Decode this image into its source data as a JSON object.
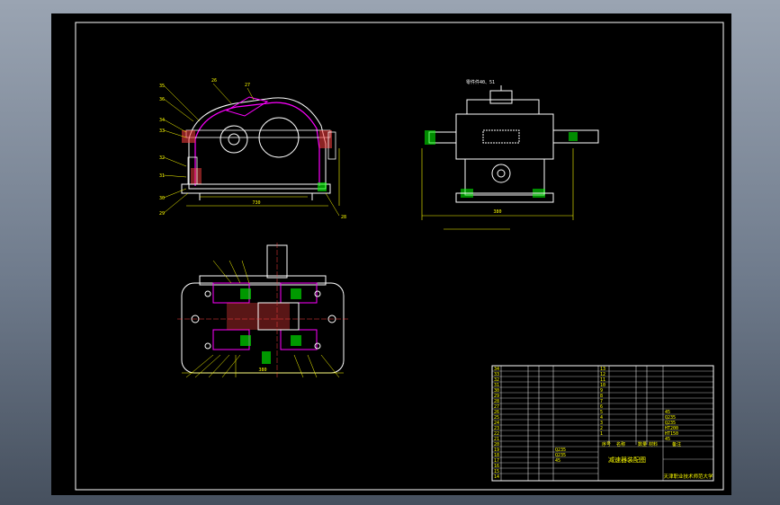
{
  "colors": {
    "background": "#000000",
    "frame": "#ffffff",
    "dimension": "#ffff00",
    "outline": "#ffffff",
    "section": "#ff00ff",
    "hatch": "#ff4040",
    "fill": "#00ff00",
    "leader": "#00ffff"
  },
  "drawing": {
    "side_view_label": "零件件40、51",
    "assembly_title": "减速器装配图",
    "institution": "天津职业技术师范大学",
    "dim_base_front": "730",
    "dim_base_side": "380",
    "dim_inner_front": "380"
  },
  "title_block": {
    "row_numbers": [
      "34",
      "33",
      "32",
      "31",
      "30",
      "29",
      "28",
      "27",
      "26",
      "25",
      "24",
      "23",
      "22",
      "21",
      "20",
      "19",
      "18",
      "17",
      "16",
      "15",
      "14"
    ],
    "row_numbers_right": [
      "13",
      "12",
      "11",
      "10",
      "9",
      "8",
      "7",
      "6",
      "5",
      "4",
      "3",
      "2",
      "1"
    ],
    "materials": [
      "45",
      "Q235",
      "Q235",
      "HT200",
      "HT150",
      "45",
      "Q235",
      "Q235",
      "45"
    ],
    "header_cells": [
      "序号",
      "名称",
      "数量",
      "材料",
      "备注"
    ]
  }
}
